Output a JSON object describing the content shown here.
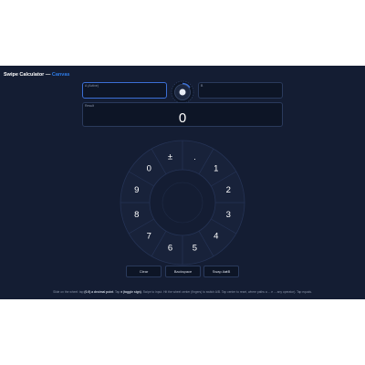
{
  "app": {
    "title": "Swipe Calculator —",
    "subtitle": "Canvas"
  },
  "fields": {
    "a_label": "A (Active)",
    "a_value": "",
    "b_label": "B",
    "b_value": "",
    "result_label": "Result",
    "result_value": "0"
  },
  "dial": {
    "labels": [
      "±",
      ".",
      "1",
      "2",
      "3",
      "4",
      "5",
      "6",
      "7",
      "8",
      "9",
      "0"
    ]
  },
  "buttons": {
    "clear": "Clear",
    "backspace": "Backspace",
    "swap": "Swap A⇄B"
  },
  "footer": {
    "text_1": "Slide on the wheel: tap ",
    "bold_1": "(0-9) ",
    "bold_2": "a decimal point",
    "text_2": ". Tap ",
    "bold_3": "± (toggle sign)",
    "text_3": ". Swipe to input. Hit the wheel center (fingers) to switch A/B. Tap center to reset, where paths a ... e ... any operator). Tap equals."
  },
  "colors": {
    "background": "#141d33",
    "accent": "#2e7ce8",
    "field_bg": "#0d1526"
  }
}
